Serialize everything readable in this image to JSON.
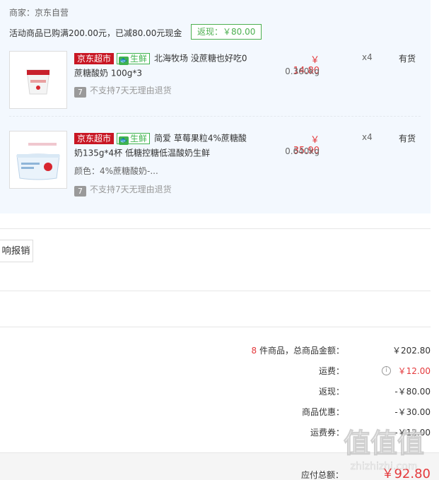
{
  "merchant": "商家：京东自营",
  "promo": {
    "text": "活动商品已购满200.00元，已减80.00元现金",
    "rebate_tag": "返现：￥80.00"
  },
  "badges": {
    "jd": "京东超市",
    "fresh": "生鲜",
    "fish_glyph": "🐟"
  },
  "items": [
    {
      "title": "北海牧场 没蔗糖也好吃0蔗糖酸奶 100g*3",
      "color": "",
      "no_return": "不支持7天无理由退货",
      "price": "￥ 14.80",
      "weight": "0.360kg",
      "qty": "x4",
      "stock": "有货"
    },
    {
      "title": "简爱 草莓果粒4%蔗糖酸奶135g*4杯 低糖控糖低温酸奶生鲜",
      "color": "颜色：4%蔗糖酸奶-...",
      "no_return": "不支持7天无理由退货",
      "price": "￥ 35.90",
      "weight": "0.640kg",
      "qty": "x4",
      "stock": "有货"
    }
  ],
  "seven_glyph": "7",
  "report_button": "响报销",
  "summary": {
    "count": "8",
    "count_label": " 件商品，总商品金额：",
    "goods_total": "￥202.80",
    "shipping_label": "运费：",
    "shipping": "￥12.00",
    "rebate_label": "返现：",
    "rebate": "-￥80.00",
    "discount_label": "商品优惠：",
    "discount": "-￥30.00",
    "shipping_coupon_label": "运费券：",
    "shipping_coupon": "-￥12.00"
  },
  "total": {
    "label": "应付总额：",
    "value": "￥92.80"
  },
  "watermark": {
    "text": "值值值",
    "domain": "zhizhizhi.com"
  },
  "colors": {
    "accent_red": "#e4393c",
    "jd_red": "#c81623",
    "fresh_green": "#3fb34f",
    "panel_bg": "#f3f8fe"
  }
}
